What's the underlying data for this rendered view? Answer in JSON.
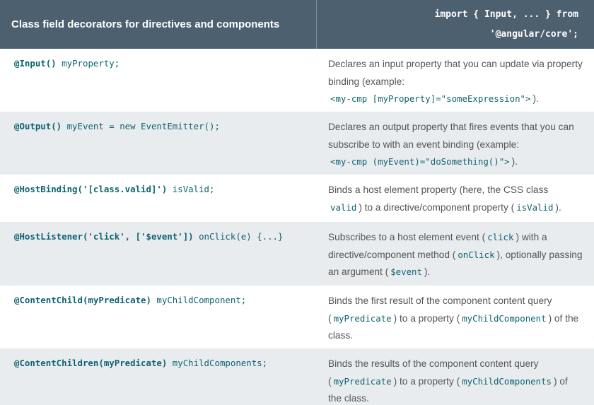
{
  "header": {
    "title": "Class field decorators for directives and components",
    "import_line1": "import { Input, ... } from",
    "import_line2": "'@angular/core';"
  },
  "rows": [
    {
      "decorator": "@Input()",
      "rest": " myProperty;",
      "desc": {
        "t1": "Declares an input property that you can update via property binding (example:",
        "c1": "<my-cmp [myProperty]=\"someExpression\">",
        "t2": ")."
      }
    },
    {
      "decorator": "@Output()",
      "rest": " myEvent = new EventEmitter();",
      "desc": {
        "t1": "Declares an output property that fires events that you can subscribe to with an event binding (example:",
        "c1": "<my-cmp (myEvent)=\"doSomething()\">",
        "t2": ")."
      }
    },
    {
      "decorator": "@HostBinding('[class.valid]')",
      "rest": " isValid;",
      "desc": {
        "t1": "Binds a host element property (here, the CSS class",
        "c1": "valid",
        "t2": ") to a directive/component property (",
        "c2": "isValid",
        "t3": ")."
      }
    },
    {
      "decorator": "@HostListener('click', ['$event'])",
      "rest": " onClick(e) {...}",
      "desc": {
        "t1": "Subscribes to a host element event (",
        "c1": "click",
        "t2": ") with a directive/component method (",
        "c2": "onClick",
        "t3": "), optionally passing an argument (",
        "c3": "$event",
        "t4": ")."
      }
    },
    {
      "decorator": "@ContentChild(myPredicate)",
      "rest": " myChildComponent;",
      "desc": {
        "t1": "Binds the first result of the component content query (",
        "c1": "myPredicate",
        "t2": ") to a property (",
        "c2": "myChildComponent",
        "t3": ") of the class."
      }
    },
    {
      "decorator": "@ContentChildren(myPredicate)",
      "rest": " myChildComponents;",
      "desc": {
        "t1": "Binds the results of the component content query (",
        "c1": "myPredicate",
        "t2": ") to a property (",
        "c2": "myChildComponents",
        "t3": ") of the class."
      }
    }
  ]
}
